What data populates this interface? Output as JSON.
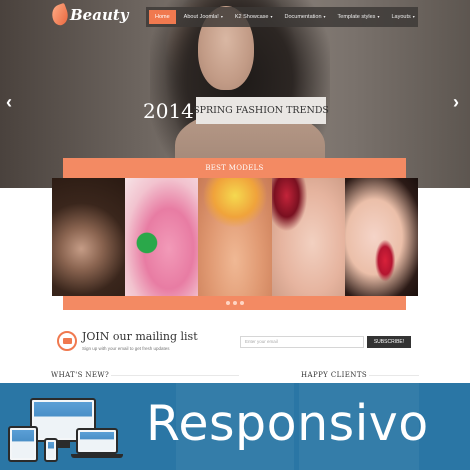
{
  "header": {
    "logo_text": "Beauty",
    "nav": [
      {
        "label": "Home",
        "caret": ""
      },
      {
        "label": "About Joomla!",
        "caret": "▾"
      },
      {
        "label": "K2 Showcase",
        "caret": "▾"
      },
      {
        "label": "Documentation",
        "caret": "▾"
      },
      {
        "label": "Template styles",
        "caret": "▾"
      },
      {
        "label": "Layouts",
        "caret": "▾"
      }
    ]
  },
  "slider": {
    "year": "2014",
    "caption": "SPRING FASHION TRENDS",
    "prev_arrow": "‹",
    "next_arrow": "›"
  },
  "best_models": {
    "title": "BEST MODELS",
    "pager_dots": 3
  },
  "mailing": {
    "title": "JOIN our mailing list",
    "subtitle": "Sign up with your email to get fresh updates",
    "input_placeholder": "Enter your email",
    "button_label": "SUBSCRIBE!"
  },
  "sections": {
    "whats_new": "WHAT'S NEW?",
    "happy_clients": "HAPPY CLIENTS"
  },
  "banner": {
    "text": "Responsivo"
  },
  "colors": {
    "accent": "#f38a63",
    "banner": "#1f6fa0",
    "nav_active": "#f0794f"
  },
  "icons": [
    "logo-leaf-icon",
    "chevron-left-icon",
    "chevron-right-icon",
    "mail-icon",
    "responsive-devices-icon"
  ]
}
